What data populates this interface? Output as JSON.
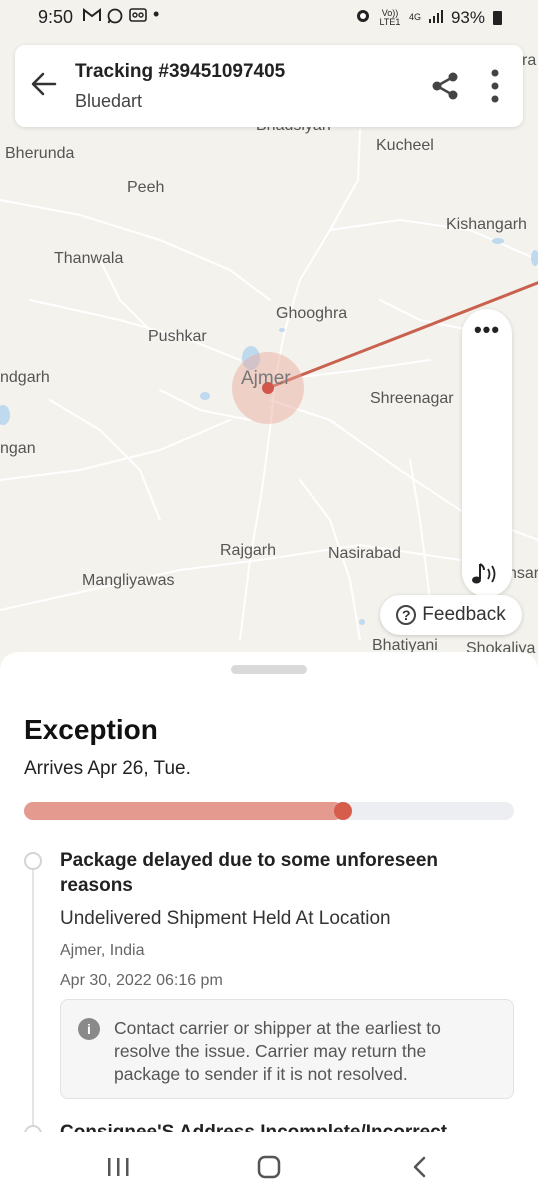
{
  "status_bar": {
    "time": "9:50",
    "left_icons": [
      "gmail-icon",
      "whatsapp-icon",
      "voicemail-icon",
      "dot-icon"
    ],
    "volte_label": "Vo)) LTE1",
    "network_label": "4G",
    "battery_percent": "93%"
  },
  "header": {
    "title": "Tracking #39451097405",
    "subtitle": "Bluedart"
  },
  "map": {
    "places": {
      "bhadasar": "Bhadsiyan",
      "kucheel": "Kucheel",
      "bherunda": "Bherunda",
      "peeh": "Peeh",
      "kishangarh": "Kishangarh",
      "thanwala": "Thanwala",
      "ghooghra": "Ghooghra",
      "pushkar": "Pushkar",
      "ndgarh": "ndgarh",
      "ajmer": "Ajmer",
      "shreenagar": "Shreenagar",
      "ngan": "ngan",
      "rajgarh": "Rajgarh",
      "nasirabad": "Nasirabad",
      "mangliyawas": "Mangliyawas",
      "nsar": "nsar",
      "bhatiyani": "Bhatiyani",
      "shokaliya": "Shokaliya",
      "ra": "ra"
    },
    "route_color": "#c9614f"
  },
  "feedback_label": "Feedback",
  "sheet": {
    "status_title": "Exception",
    "arrives": "Arrives Apr 26, Tue.",
    "progress_fraction": 0.65,
    "progress_color": "#e59a8f",
    "progress_knob_color": "#d65c4c",
    "events": [
      {
        "title": "Package delayed due to some unforeseen reasons",
        "description": "Undelivered Shipment Held At Location",
        "location": "Ajmer, India",
        "time": "Apr 30, 2022 06:16 pm",
        "notice": "Contact carrier or shipper at the earliest to resolve the issue. Carrier may return the package to sender if it is not resolved."
      },
      {
        "title": "Consignee'S Address Incomplete/Incorrect"
      }
    ]
  }
}
